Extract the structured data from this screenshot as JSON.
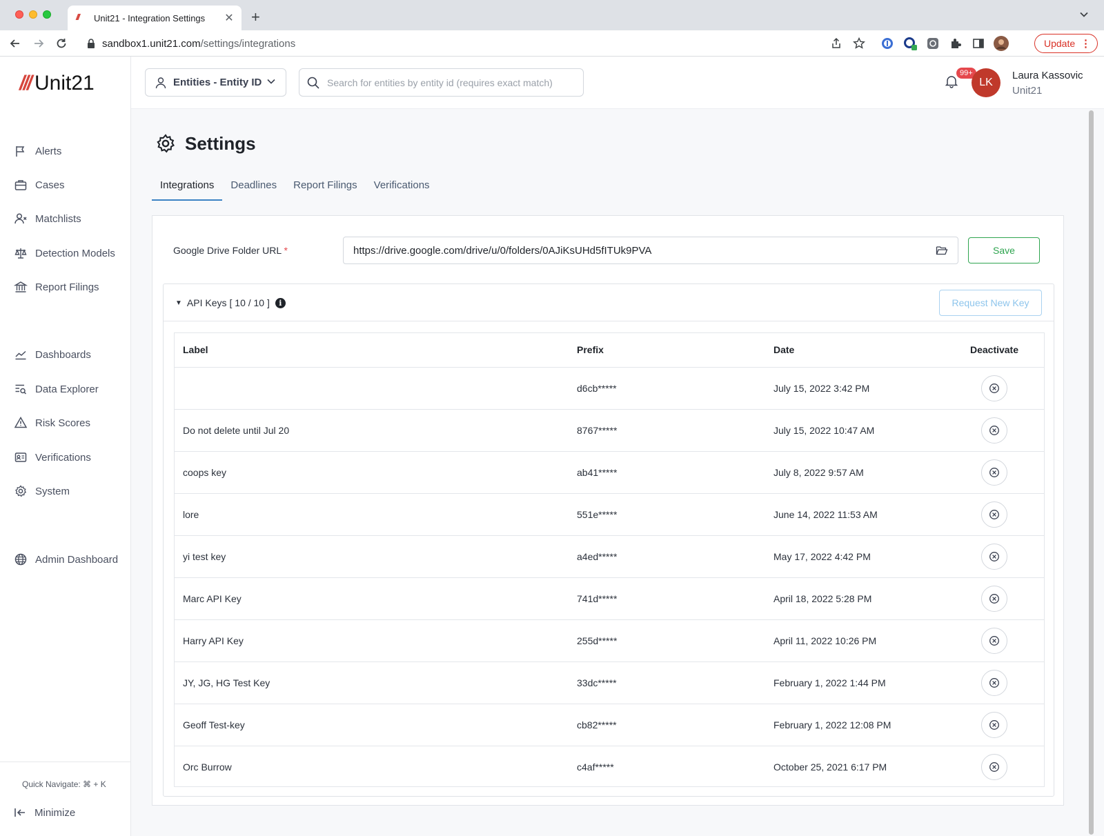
{
  "browser": {
    "tab_title": "Unit21 - Integration Settings",
    "url_host": "sandbox1.unit21.com",
    "url_path": "/settings/integrations",
    "update_label": "Update"
  },
  "brand": {
    "name": "Unit21",
    "accent": "#d6453d"
  },
  "sidebar": {
    "items": [
      {
        "label": "Alerts",
        "icon": "flag-icon"
      },
      {
        "label": "Cases",
        "icon": "briefcase-icon"
      },
      {
        "label": "Matchlists",
        "icon": "user-x-icon"
      },
      {
        "label": "Detection Models",
        "icon": "scale-icon"
      },
      {
        "label": "Report Filings",
        "icon": "bank-icon"
      },
      {
        "label": "Dashboards",
        "icon": "chart-line-icon"
      },
      {
        "label": "Data Explorer",
        "icon": "list-search-icon"
      },
      {
        "label": "Risk Scores",
        "icon": "warning-icon"
      },
      {
        "label": "Verifications",
        "icon": "id-card-icon"
      },
      {
        "label": "System",
        "icon": "gear-icon"
      },
      {
        "label": "Admin Dashboard",
        "icon": "globe-icon"
      }
    ],
    "quick_navigate": "Quick Navigate: ⌘ + K",
    "minimize_label": "Minimize"
  },
  "topbar": {
    "entity_select": "Entities - Entity ID",
    "search_placeholder": "Search for entities by entity id (requires exact match)",
    "notif_count": "99+",
    "avatar_initials": "LK",
    "user_name": "Laura Kassovic",
    "user_org": "Unit21"
  },
  "page": {
    "title": "Settings",
    "tabs": [
      "Integrations",
      "Deadlines",
      "Report Filings",
      "Verifications"
    ],
    "active_tab": "Integrations"
  },
  "google_drive": {
    "label": "Google Drive Folder URL",
    "required_mark": "*",
    "value": "https://drive.google.com/drive/u/0/folders/0AJiKsUHd5fITUk9PVA",
    "save_label": "Save"
  },
  "api_keys": {
    "title": "API Keys",
    "count": "[ 10 / 10 ]",
    "request_label": "Request New Key",
    "columns": [
      "Label",
      "Prefix",
      "Date",
      "Deactivate"
    ],
    "rows": [
      {
        "label": "",
        "prefix": "d6cb*****",
        "date": "July 15, 2022 3:42 PM"
      },
      {
        "label": "Do not delete until Jul 20",
        "prefix": "8767*****",
        "date": "July 15, 2022 10:47 AM"
      },
      {
        "label": "coops key",
        "prefix": "ab41*****",
        "date": "July 8, 2022 9:57 AM"
      },
      {
        "label": "lore",
        "prefix": "551e*****",
        "date": "June 14, 2022 11:53 AM"
      },
      {
        "label": "yi test key",
        "prefix": "a4ed*****",
        "date": "May 17, 2022 4:42 PM"
      },
      {
        "label": "Marc API Key",
        "prefix": "741d*****",
        "date": "April 18, 2022 5:28 PM"
      },
      {
        "label": "Harry API Key",
        "prefix": "255d*****",
        "date": "April 11, 2022 10:26 PM"
      },
      {
        "label": "JY, JG, HG Test Key",
        "prefix": "33dc*****",
        "date": "February 1, 2022 1:44 PM"
      },
      {
        "label": "Geoff Test-key",
        "prefix": "cb82*****",
        "date": "February 1, 2022 12:08 PM"
      },
      {
        "label": "Orc Burrow",
        "prefix": "c4af*****",
        "date": "October 25, 2021 6:17 PM"
      }
    ]
  }
}
